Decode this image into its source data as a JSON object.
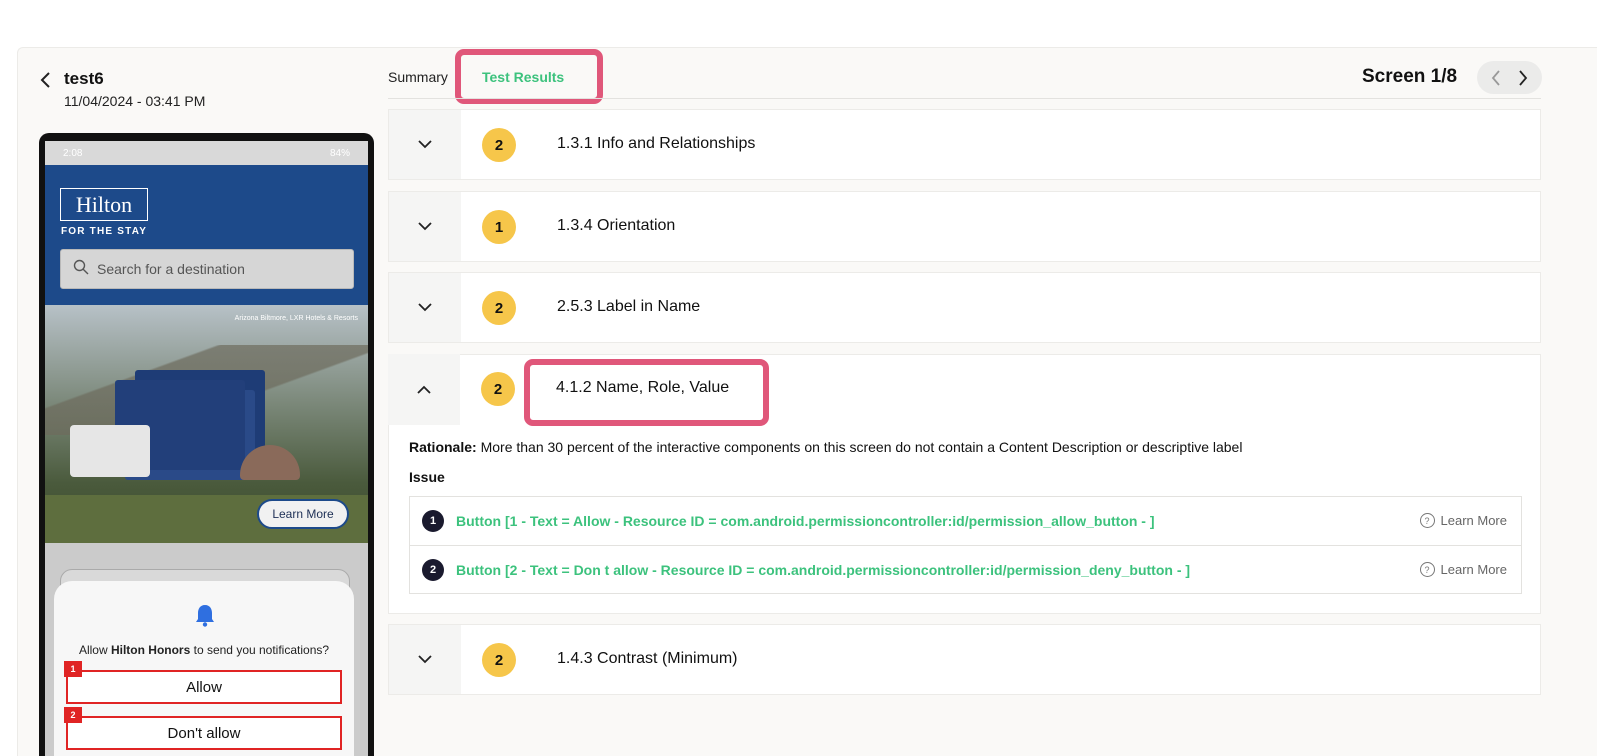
{
  "header": {
    "title": "test6",
    "date": "11/04/2024 - 03:41 PM"
  },
  "tabs": [
    {
      "label": "Summary",
      "active": false
    },
    {
      "label": "Test Results",
      "active": true
    }
  ],
  "screen": {
    "label": "Screen 1/8"
  },
  "phone": {
    "status_time": "2:08",
    "status_right": "84%",
    "brand": "Hilton",
    "tagline": "FOR THE STAY",
    "search_placeholder": "Search for a destination",
    "hero_location": "Arizona Biltmore, LXR Hotels & Resorts",
    "learn_more": "Learn More",
    "dialog": {
      "prefix": "Allow ",
      "app_name": "Hilton Honors",
      "suffix": " to send you notifications?",
      "allow": "Allow",
      "deny": "Don't allow",
      "badge_1": "1",
      "badge_2": "2"
    }
  },
  "results": [
    {
      "count": "2",
      "title": "1.3.1 Info and Relationships",
      "expanded": false
    },
    {
      "count": "1",
      "title": "1.3.4 Orientation",
      "expanded": false
    },
    {
      "count": "2",
      "title": "2.5.3 Label in Name",
      "expanded": false
    },
    {
      "count": "2",
      "title": "4.1.2 Name, Role, Value",
      "expanded": true,
      "rationale_label": "Rationale:",
      "rationale": "More than 30 percent of the interactive components on this screen do not contain a Content Description or descriptive label",
      "issue_label": "Issue",
      "issues": [
        {
          "num": "1",
          "text": "Button [1 - Text = Allow - Resource ID = com.android.permissioncontroller:id/permission_allow_button - ]",
          "learn": "Learn More"
        },
        {
          "num": "2",
          "text": "Button [2 - Text = Don t allow - Resource ID = com.android.permissioncontroller:id/permission_deny_button - ]",
          "learn": "Learn More"
        }
      ]
    },
    {
      "count": "2",
      "title": "1.4.3 Contrast (Minimum)",
      "expanded": false
    }
  ],
  "colors": {
    "accent_green": "#3cc27d",
    "highlight_pink": "#e0577a",
    "badge_yellow": "#f6c64a",
    "annotation_red": "#e02424",
    "hilton_blue": "#1d4a8a"
  }
}
